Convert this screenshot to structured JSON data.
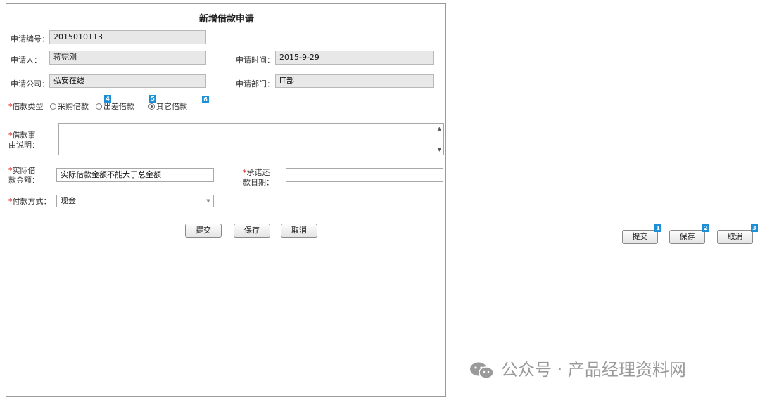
{
  "form": {
    "title": "新增借款申请",
    "application_no": {
      "label": "申请编号：",
      "value": "2015010113"
    },
    "applicant": {
      "label": "申请人：",
      "value": "蒋宪刚"
    },
    "apply_time": {
      "label": "申请时间：",
      "value": "2015-9-29"
    },
    "company": {
      "label": "申请公司：",
      "value": "弘安在线"
    },
    "department": {
      "label": "申请部门：",
      "value": "IT部"
    },
    "loan_type": {
      "required_mark": "*",
      "label": "借款类型",
      "options": [
        "采购借款",
        "出差借款",
        "其它借款"
      ],
      "selected": "其它借款"
    },
    "reason": {
      "required_mark": "*",
      "label_line1": "借款事",
      "label_line2": "由说明：",
      "value": ""
    },
    "amount": {
      "required_mark": "*",
      "label_line1": "实际借",
      "label_line2": "款金额：",
      "value": "实际借款金额不能大于总金额"
    },
    "repay_date": {
      "required_mark": "*",
      "label_line1": "承诺还",
      "label_line2": "款日期：",
      "value": ""
    },
    "payment": {
      "required_mark": "*",
      "label": "付款方式：",
      "value": "现金"
    },
    "buttons": {
      "submit": "提交",
      "save": "保存",
      "cancel": "取消"
    }
  },
  "annotations": {
    "badges": [
      "1",
      "2",
      "3",
      "4",
      "5",
      "6"
    ],
    "buttons": {
      "submit": "提交",
      "save": "保存",
      "cancel": "取消"
    },
    "badge_color": "#1d8fd6"
  },
  "watermark": {
    "text": "公众号 · 产品经理资料网",
    "icon": "wechat-icon"
  }
}
